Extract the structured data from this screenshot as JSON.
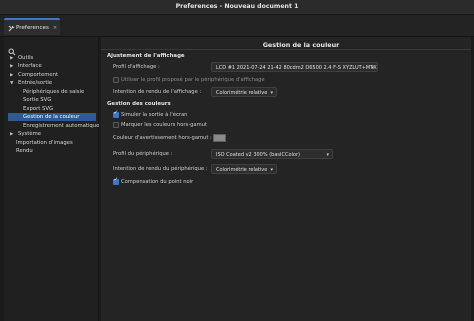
{
  "window": {
    "title": "Preferences - Nouveau document 1"
  },
  "tab": {
    "label": "Preferences",
    "close": "×"
  },
  "sidebar": {
    "items": [
      {
        "label": "Outils",
        "arrow": "▶"
      },
      {
        "label": "Interface",
        "arrow": "▶"
      },
      {
        "label": "Comportement",
        "arrow": "▶"
      },
      {
        "label": "Entrée/sortie",
        "arrow": "▼"
      },
      {
        "label": "Périphériques de saisie",
        "arrow": ""
      },
      {
        "label": "Sortie SVG",
        "arrow": ""
      },
      {
        "label": "Export SVG",
        "arrow": ""
      },
      {
        "label": "Gestion de la couleur",
        "arrow": "",
        "selected": true
      },
      {
        "label": "Enregistrement automatique",
        "arrow": ""
      },
      {
        "label": "Système",
        "arrow": "▶"
      },
      {
        "label": "Importation d'images",
        "arrow": ""
      },
      {
        "label": "Rendu",
        "arrow": ""
      }
    ]
  },
  "main": {
    "title": "Gestion de la couleur",
    "display": {
      "section": "Ajustement de l'affichage",
      "profile_label": "Profil d'affichage :",
      "profile_value": "LCD #1 2021-07-24 21-42 80cdm2 D6500 2.4 F-S XYZLUT+MTX",
      "use_device_label": "Utiliser le profil proposé par le périphérique d'affichage",
      "use_device_checked": false,
      "intent_label": "Intention de rendu de l'affichage :",
      "intent_value": "Colorimétrie relative"
    },
    "proofing": {
      "section": "Gestion des couleurs",
      "simulate_label": "Simuler la sortie à l'écran",
      "simulate_checked": true,
      "gamut_label": "Marquer les couleurs hors-gamut",
      "gamut_checked": false,
      "warning_color_label": "Couleur d'avertissement hors-gamut :",
      "warning_color": "#8a8a8a",
      "device_profile_label": "Profil du périphérique :",
      "device_profile_value": "ISO Coated v2 300% (basICColor)",
      "device_intent_label": "Intention de rendu du périphérique :",
      "device_intent_value": "Colorimétrie relative",
      "bpc_label": "Compensation du point noir",
      "bpc_checked": true
    }
  },
  "colors": {
    "accent": "#3d78c6",
    "selection": "#2f5a8f"
  }
}
